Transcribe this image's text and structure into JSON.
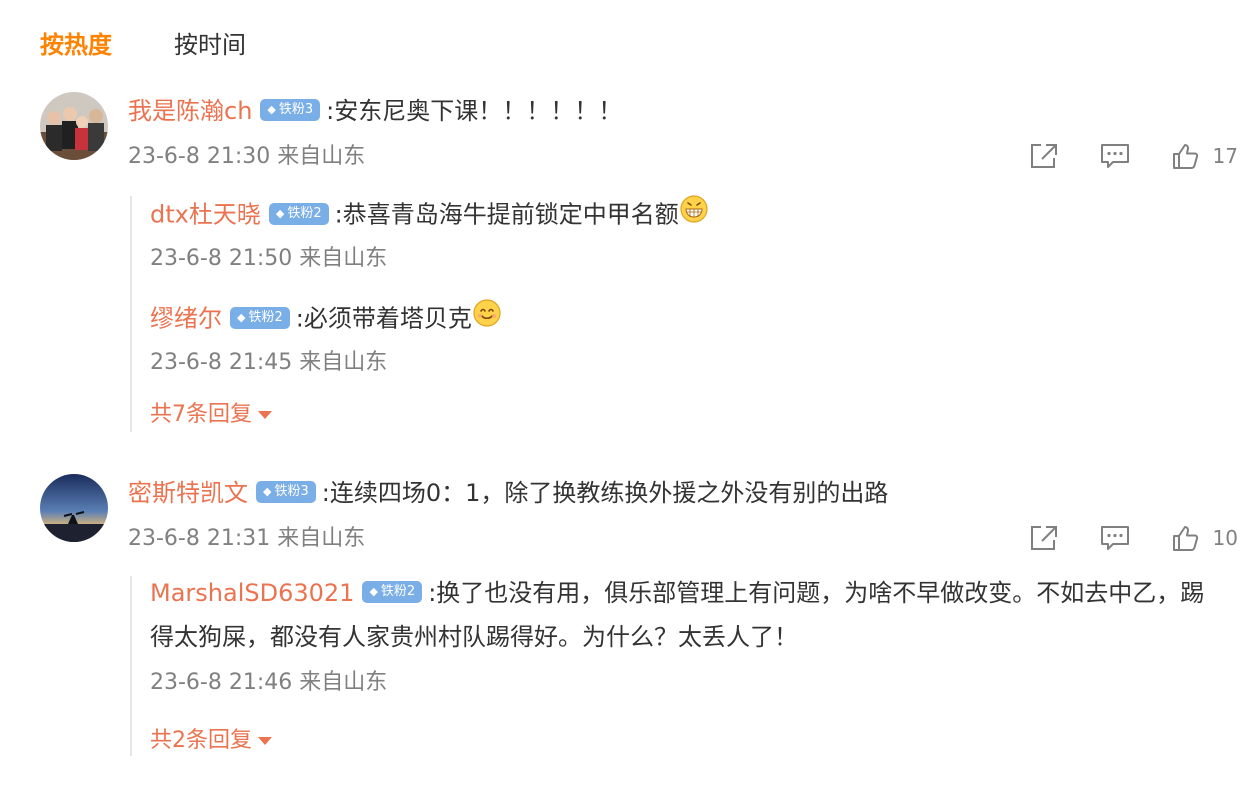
{
  "tabs": [
    {
      "label": "按热度",
      "active": true
    },
    {
      "label": "按时间",
      "active": false
    }
  ],
  "comments": [
    {
      "user": "我是陈瀚ch",
      "badge": "铁粉3",
      "text": ":安东尼奥下课！！！！！！",
      "meta": "23-6-8 21:30 来自山东",
      "likes": "17",
      "replies": [
        {
          "user": "dtx杜天晓",
          "badge": "铁粉2",
          "text": ":恭喜青岛海牛提前锁定中甲名额",
          "emoji": "grin-emoji",
          "meta": "23-6-8 21:50 来自山东"
        },
        {
          "user": "缪绪尔",
          "badge": "铁粉2",
          "text": ":必须带着塔贝克",
          "emoji": "smile-emoji",
          "meta": "23-6-8 21:45 来自山东"
        }
      ],
      "more": "共7条回复"
    },
    {
      "user": "密斯特凯文",
      "badge": "铁粉3",
      "text": ":连续四场0：1，除了换教练换外援之外没有别的出路",
      "meta": "23-6-8 21:31 来自山东",
      "likes": "10",
      "replies": [
        {
          "user": "MarshalSD63021",
          "badge": "铁粉2",
          "text": ":换了也没有用，俱乐部管理上有问题，为啥不早做改变。不如去中乙，踢得太狗屎，都没有人家贵州村队踢得好。为什么？太丢人了！",
          "meta": "23-6-8 21:46 来自山东"
        }
      ],
      "more": "共2条回复"
    }
  ],
  "colors": {
    "accent": "#ff8200",
    "username": "#eb7350",
    "badge": "#7aaee6",
    "meta": "#808080"
  },
  "icons": [
    "share-icon",
    "comment-icon",
    "like-icon",
    "diamond-icon"
  ]
}
